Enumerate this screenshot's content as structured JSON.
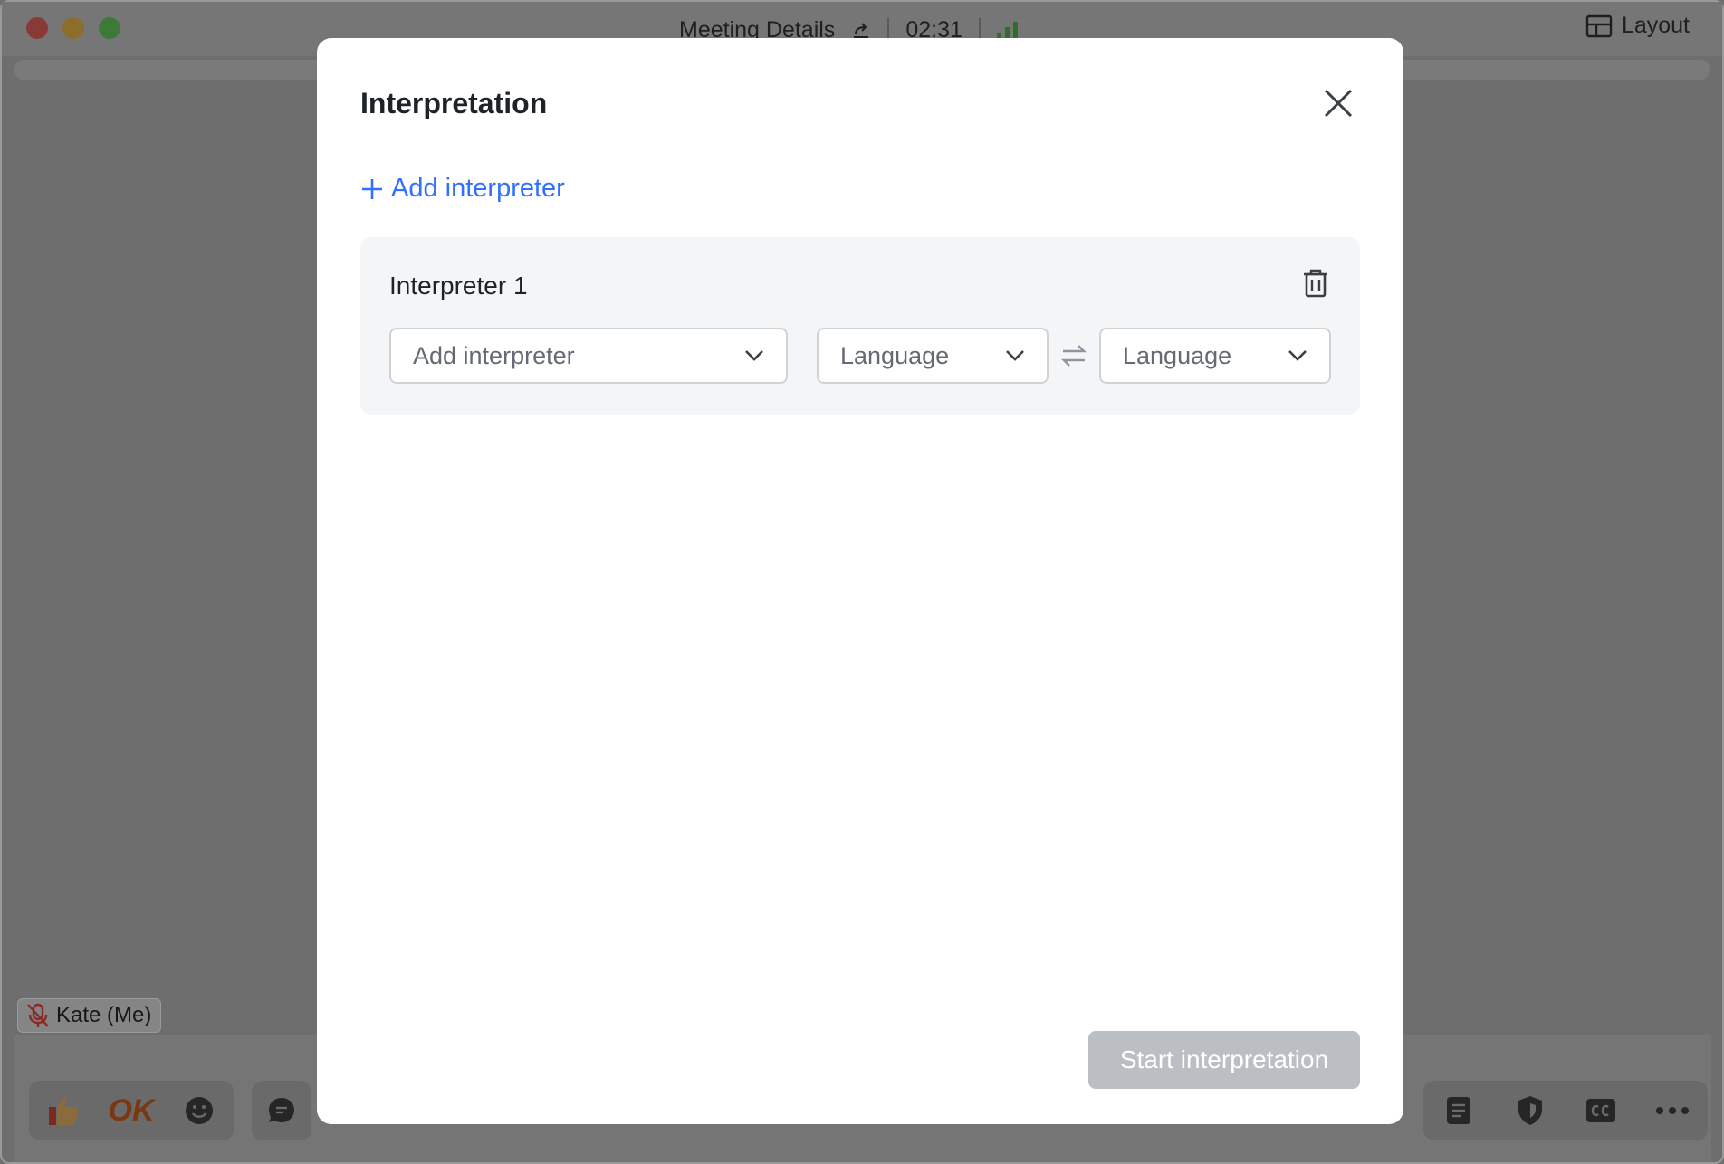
{
  "window": {
    "title": "Meeting Details",
    "timer": "02:31",
    "layout_label": "Layout",
    "participant_name": "Kate (Me)",
    "reaction_ok": "OK"
  },
  "modal": {
    "title": "Interpretation",
    "add_interpreter_link": "Add interpreter",
    "interpreter_card": {
      "title": "Interpreter 1",
      "interpreter_placeholder": "Add interpreter",
      "source_language_placeholder": "Language",
      "target_language_placeholder": "Language"
    },
    "start_button": "Start interpretation"
  },
  "colors": {
    "accent": "#3370ff",
    "disabled_button": "#bbbfc4",
    "card_background": "#f4f5f6",
    "overlay": "#6e6e6f"
  },
  "icons": [
    "share-icon",
    "signal-icon",
    "layout-grid-icon",
    "mic-muted-icon",
    "thumbs-up-icon",
    "smile-icon",
    "chat-icon",
    "close-icon",
    "plus-icon",
    "trash-icon",
    "chevron-down-icon",
    "swap-icon",
    "notes-icon",
    "shield-icon",
    "cc-icon",
    "more-icon"
  ]
}
